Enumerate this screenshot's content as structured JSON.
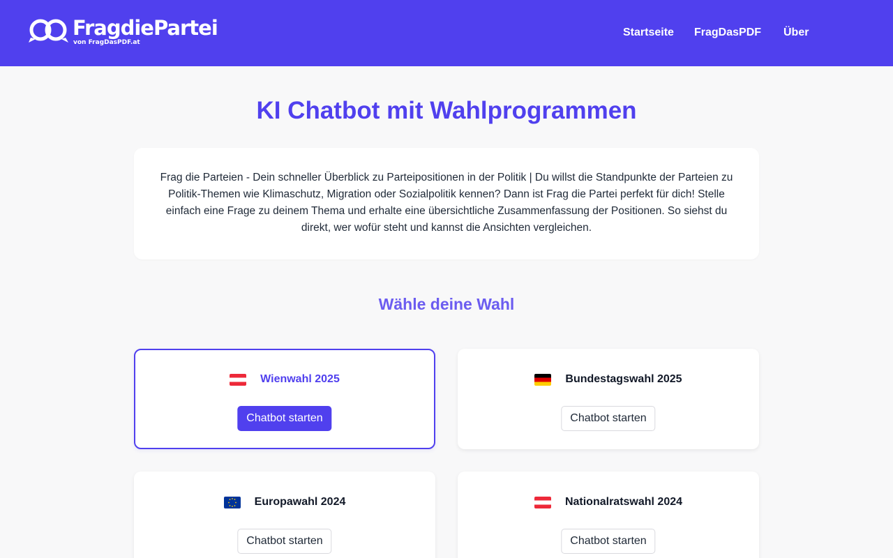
{
  "header": {
    "logo_text": "FragdiePartei",
    "logo_subtext": "von FragDasPDF.at",
    "nav": [
      {
        "label": "Startseite"
      },
      {
        "label": "FragDasPDF"
      },
      {
        "label": "Über"
      }
    ]
  },
  "main": {
    "title": "KI Chatbot mit Wahlprogrammen",
    "intro": "Frag die Parteien - Dein schneller Überblick zu Parteipositionen in der Politik | Du willst die Standpunkte der Parteien zu Politik-Themen wie Klimaschutz, Migration oder Sozialpolitik kennen? Dann ist Frag die Partei perfekt für dich! Stelle einfach eine Frage zu deinem Thema und erhalte eine übersichtliche Zusammenfassung der Positionen. So siehst du direkt, wer wofür steht und kannst die Ansichten vergleichen.",
    "section_title": "Wähle deine Wahl",
    "elections": [
      {
        "label": "Wienwahl 2025",
        "flag": "austria-flag-icon",
        "button": "Chatbot starten",
        "selected": true
      },
      {
        "label": "Bundestagswahl 2025",
        "flag": "germany-flag-icon",
        "button": "Chatbot starten",
        "selected": false
      },
      {
        "label": "Europawahl 2024",
        "flag": "eu-flag-icon",
        "button": "Chatbot starten",
        "selected": false
      },
      {
        "label": "Nationalratswahl 2024",
        "flag": "austria-flag-icon",
        "button": "Chatbot starten",
        "selected": false
      }
    ]
  },
  "colors": {
    "brand": "#5040EE",
    "section_title": "#6B5CF0",
    "background": "#F8F8F9",
    "card": "#FFFFFF"
  }
}
